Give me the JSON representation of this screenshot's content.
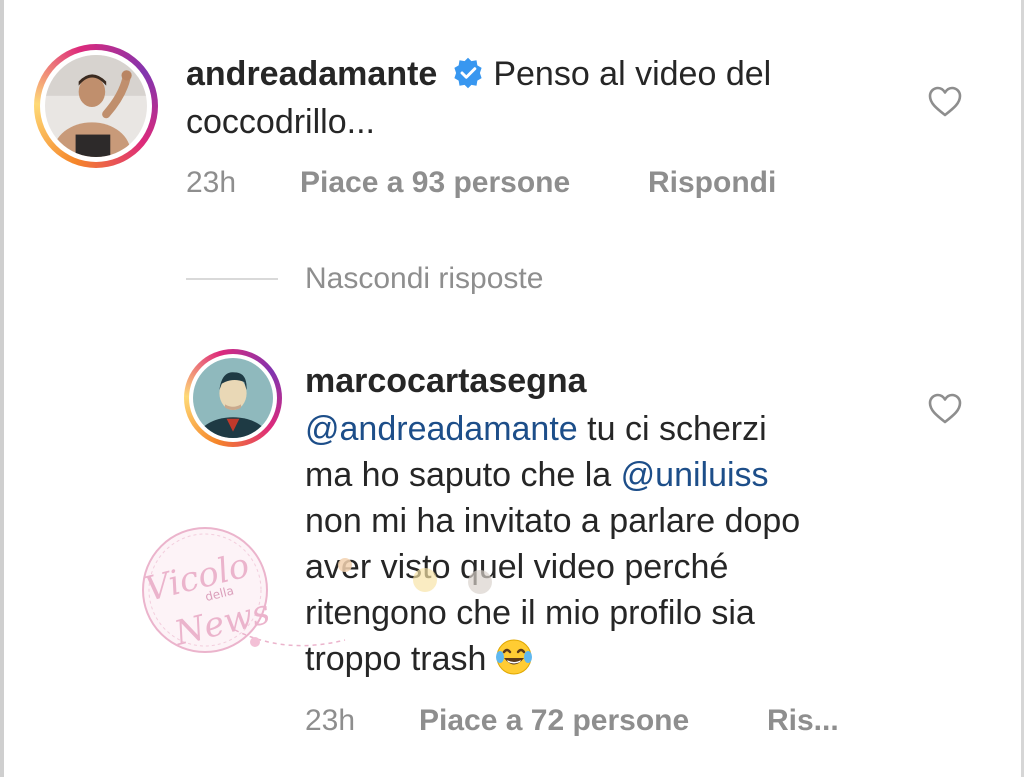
{
  "comment": {
    "username": "andreadamante",
    "verified": true,
    "text_line1": "Penso al video del",
    "text_line2": "coccodrillo...",
    "time": "23h",
    "likes": "Piace a 93 persone",
    "reply_label": "Rispondi"
  },
  "hide_replies_label": "Nascondi risposte",
  "reply": {
    "username": "marcocartasegna",
    "mention1": "@andreadamante",
    "line1_rest": " tu ci scherzi",
    "line2_start": "ma ho saputo che la ",
    "mention2": "@uniluiss",
    "line3": "non mi ha invitato a parlare dopo",
    "line4": "aver visto quel video perché",
    "line5": "ritengono che il mio profilo sia",
    "line6": "troppo trash",
    "emoji": "face-with-tears-of-joy",
    "time": "23h",
    "likes": "Piace a 72 persone",
    "reply_label": "Ris..."
  },
  "watermark": {
    "line1": "Vicolo",
    "line2": "della",
    "line3": "News"
  },
  "colors": {
    "text": "#262626",
    "meta": "#8e8e8e",
    "mention": "#1d4e89",
    "verified": "#3897f0",
    "watermark": "#e8a7c4"
  }
}
